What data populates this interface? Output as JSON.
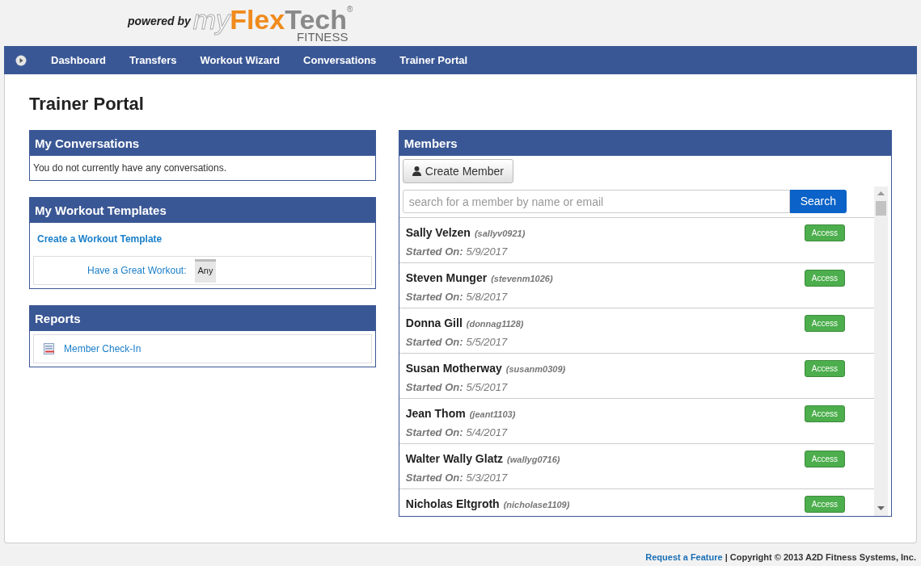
{
  "logo": {
    "prefix": "powered by",
    "part_1": "my",
    "part_2": "Flex",
    "part_3": "Tech",
    "mark": "®",
    "part_4": "FITNESS"
  },
  "nav": [
    "Dashboard",
    "Transfers",
    "Workout Wizard",
    "Conversations",
    "Trainer Portal"
  ],
  "page_title": "Trainer Portal",
  "conversations": {
    "title": "My Conversations",
    "message": "You do not currently have any conversations."
  },
  "templates": {
    "title": "My Workout Templates",
    "create_link": "Create a Workout Template",
    "items": [
      {
        "name": "Have a Great Workout:",
        "tag": "Any"
      }
    ]
  },
  "reports": {
    "title": "Reports",
    "items": [
      "Member Check-In"
    ]
  },
  "members": {
    "title": "Members",
    "create_button": "Create Member",
    "search": {
      "placeholder": "search for a member by name or email",
      "button": "Search"
    },
    "rows": [
      {
        "name": "Sally Velzen",
        "username": "(sallyv0921)",
        "started_label": "Started On:",
        "started": "5/9/2017",
        "action": "Access"
      },
      {
        "name": "Steven Munger",
        "username": "(stevenm1026)",
        "started_label": "Started On:",
        "started": "5/8/2017",
        "action": "Access"
      },
      {
        "name": "Donna Gill",
        "username": "(donnag1128)",
        "started_label": "Started On:",
        "started": "5/5/2017",
        "action": "Access"
      },
      {
        "name": "Susan Motherway",
        "username": "(susanm0309)",
        "started_label": "Started On:",
        "started": "5/5/2017",
        "action": "Access"
      },
      {
        "name": "Jean Thom",
        "username": "(jeant1103)",
        "started_label": "Started On:",
        "started": "5/4/2017",
        "action": "Access"
      },
      {
        "name": "Walter Wally Glatz",
        "username": "(wallyg0716)",
        "started_label": "Started On:",
        "started": "5/3/2017",
        "action": "Access"
      },
      {
        "name": "Nicholas Eltgroth",
        "username": "(nicholase1109)",
        "action": "Access"
      }
    ]
  },
  "footer": {
    "link": "Request a Feature",
    "text": "| Copyright © 2013 A2D Fitness Systems, Inc."
  }
}
